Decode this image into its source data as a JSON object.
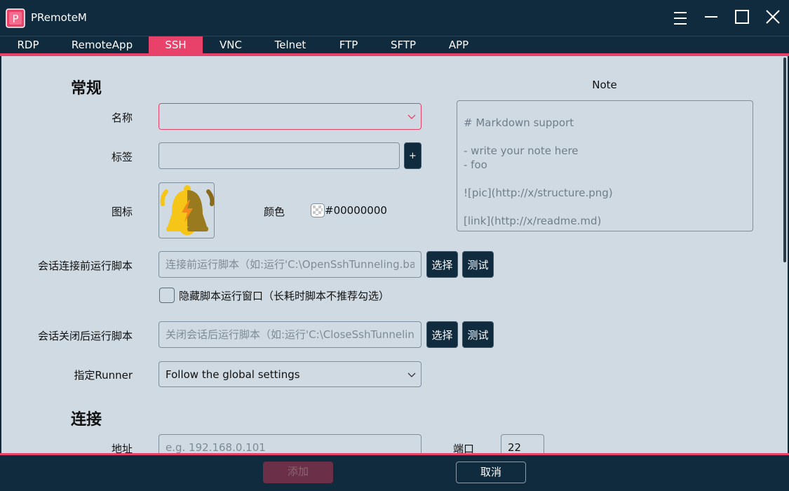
{
  "app": {
    "title": "PRemoteM",
    "logo_letter": "P"
  },
  "tabs": [
    "RDP",
    "RemoteApp",
    "SSH",
    "VNC",
    "Telnet",
    "FTP",
    "SFTP",
    "APP"
  ],
  "active_tab": "SSH",
  "general": {
    "section_title": "常规",
    "name_label": "名称",
    "name_value": "",
    "tags_label": "标签",
    "tags_value": "",
    "add_tag_label": "+",
    "icon_label": "图标",
    "color_label": "颜色",
    "color_value": "#00000000",
    "note_title": "Note",
    "note_placeholder": "# Markdown support\n\n- write your note here\n- foo\n\n![pic](http://x/structure.png)\n\n[link](http://x/readme.md)",
    "pre_script_label": "会话连接前运行脚本",
    "pre_script_placeholder": "连接前运行脚本（如:运行'C:\\OpenSshTunneling.bat'）",
    "select_label": "选择",
    "test_label": "测试",
    "hide_window_label": "隐藏脚本运行窗口（长耗时脚本不推荐勾选）",
    "hide_window_checked": false,
    "post_script_label": "会话关闭后运行脚本",
    "post_script_placeholder": "关闭会话后运行脚本（如:运行'C:\\CloseSshTunneling.bat'）",
    "runner_label": "指定Runner",
    "runner_value": "Follow the global settings"
  },
  "connection": {
    "section_title": "连接",
    "address_label": "地址",
    "address_placeholder": "e.g. 192.168.0.101",
    "port_label": "端口",
    "port_value": "22"
  },
  "footer": {
    "add_label": "添加",
    "cancel_label": "取消"
  },
  "colors": {
    "accent": "#e8416a",
    "dark": "#102a3e",
    "panel": "#cfdae3"
  },
  "icons": [
    "menu-icon",
    "minimize-icon",
    "maximize-icon",
    "close-icon",
    "chevron-down-icon",
    "bell-icon"
  ]
}
